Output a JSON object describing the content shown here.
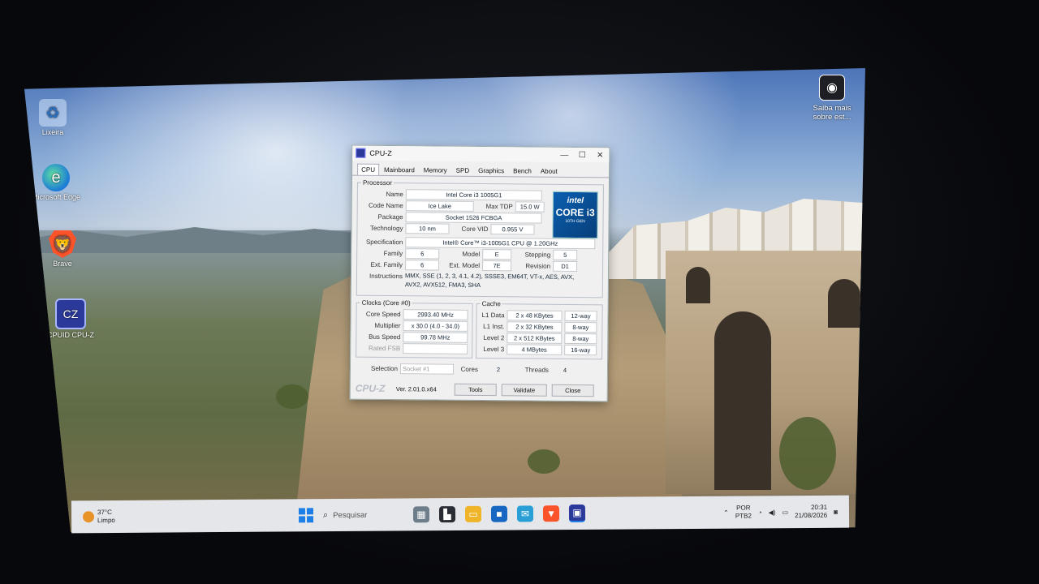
{
  "desktop": {
    "icons": [
      {
        "label": "Lixeira",
        "glyph": "♻"
      },
      {
        "label": "Microsoft Edge",
        "glyph": "e"
      },
      {
        "label": "Brave",
        "glyph": "🦁"
      },
      {
        "label": "CPUID CPU-Z",
        "glyph": "CZ"
      }
    ],
    "learn_more": {
      "label": "Saiba mais sobre est...",
      "glyph": "◉"
    }
  },
  "window": {
    "title": "CPU-Z",
    "controls": {
      "minimize": "—",
      "maximize": "☐",
      "close": "✕"
    },
    "tabs": [
      "CPU",
      "Mainboard",
      "Memory",
      "SPD",
      "Graphics",
      "Bench",
      "About"
    ],
    "processor": {
      "legend": "Processor",
      "name_label": "Name",
      "name": "Intel Core i3 1005G1",
      "code_name_label": "Code Name",
      "code_name": "Ice Lake",
      "max_tdp_label": "Max TDP",
      "max_tdp": "15.0 W",
      "package_label": "Package",
      "package": "Socket 1526 FCBGA",
      "technology_label": "Technology",
      "technology": "10 nm",
      "core_vid_label": "Core VID",
      "core_vid": "0.955 V",
      "specification_label": "Specification",
      "specification": "Intel® Core™ i3-1005G1 CPU @ 1.20GHz",
      "family_label": "Family",
      "family": "6",
      "model_label": "Model",
      "model": "E",
      "stepping_label": "Stepping",
      "stepping": "5",
      "ext_family_label": "Ext. Family",
      "ext_family": "6",
      "ext_model_label": "Ext. Model",
      "ext_model": "7E",
      "revision_label": "Revision",
      "revision": "D1",
      "instructions_label": "Instructions",
      "instructions_line1": "MMX, SSE (1, 2, 3, 4.1, 4.2), SSSE3, EM64T, VT-x, AES, AVX,",
      "instructions_line2": "AVX2, AVX512, FMA3, SHA",
      "logo_brand": "intel",
      "logo_model": "CORE i3",
      "logo_gen": "10TH GEN"
    },
    "clocks": {
      "legend": "Clocks (Core #0)",
      "core_speed_label": "Core Speed",
      "core_speed": "2993.40 MHz",
      "multiplier_label": "Multiplier",
      "multiplier": "x 30.0 (4.0 - 34.0)",
      "bus_speed_label": "Bus Speed",
      "bus_speed": "99.78 MHz",
      "rated_fsb_label": "Rated FSB",
      "rated_fsb": ""
    },
    "cache": {
      "legend": "Cache",
      "rows": [
        {
          "label": "L1 Data",
          "size": "2 x 48 KBytes",
          "way": "12-way"
        },
        {
          "label": "L1 Inst.",
          "size": "2 x 32 KBytes",
          "way": "8-way"
        },
        {
          "label": "Level 2",
          "size": "2 x 512 KBytes",
          "way": "8-way"
        },
        {
          "label": "Level 3",
          "size": "4 MBytes",
          "way": "16-way"
        }
      ]
    },
    "selection": {
      "label": "Selection",
      "value": "Socket #1",
      "cores_label": "Cores",
      "cores": "2",
      "threads_label": "Threads",
      "threads": "4"
    },
    "footer": {
      "logo": "CPU-Z",
      "version": "Ver. 2.01.0.x64",
      "tools": "Tools",
      "validate": "Validate",
      "close": "Close"
    }
  },
  "taskbar": {
    "weather_temp": "37°C",
    "weather_desc": "Limpo",
    "search_placeholder": "Pesquisar",
    "lang_line1": "POR",
    "lang_line2": "PTB2",
    "time": "20:31",
    "date": "21/08/2026",
    "colors": {
      "accent": "#1d7ee8"
    }
  }
}
